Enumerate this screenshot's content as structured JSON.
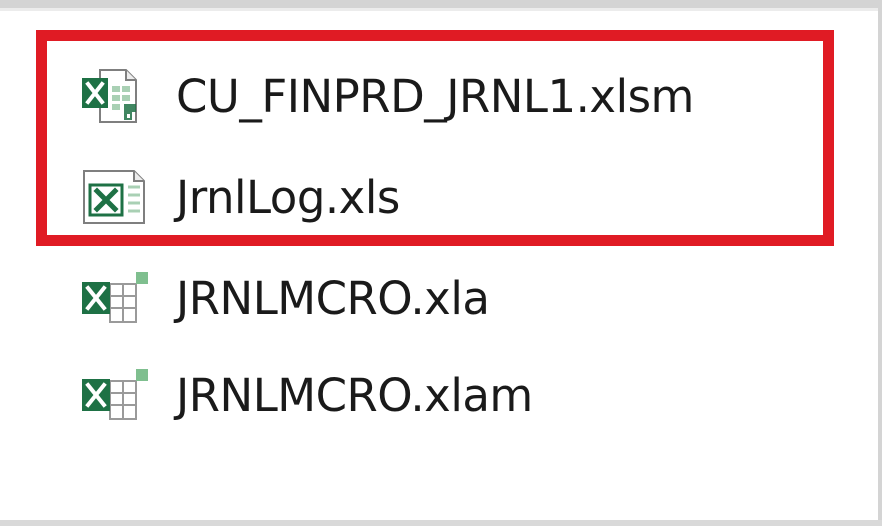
{
  "files": [
    {
      "name": "CU_FINPRD_JRNL1.xlsm",
      "icon": "excel-macro-workbook-icon"
    },
    {
      "name": "JrnlLog.xls",
      "icon": "excel-97-workbook-icon"
    },
    {
      "name": "JRNLMCRO.xla",
      "icon": "excel-addin-icon"
    },
    {
      "name": "JRNLMCRO.xlam",
      "icon": "excel-addin-icon"
    }
  ],
  "colors": {
    "highlight": "#e01b24",
    "excel_green": "#1e7145",
    "text": "#1a1a1a"
  }
}
